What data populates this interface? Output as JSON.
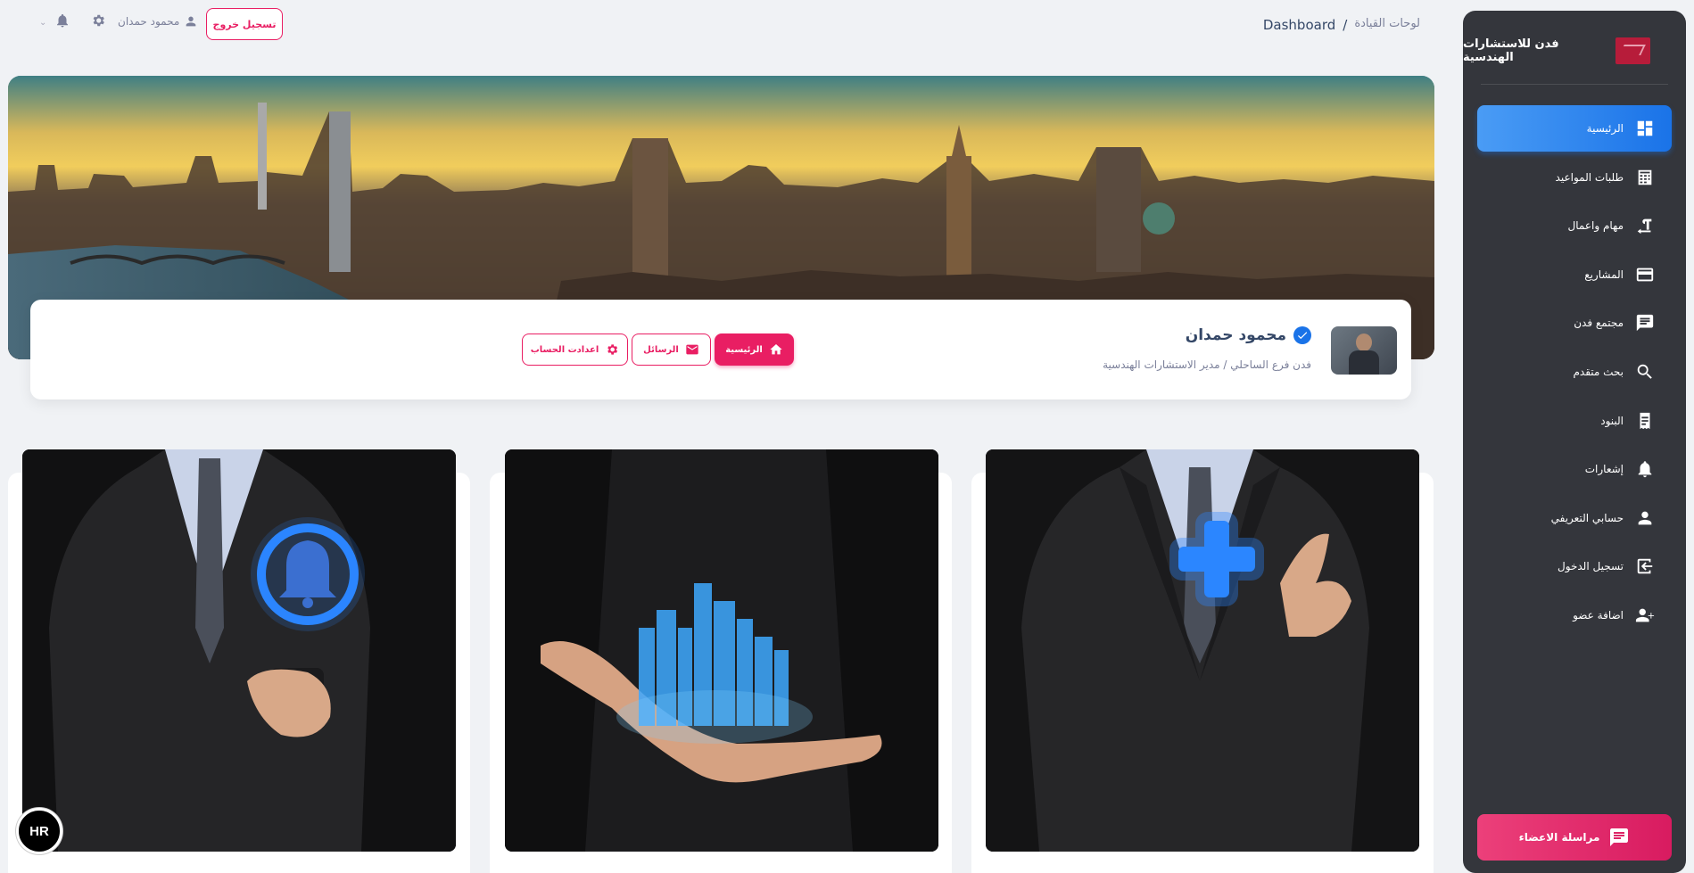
{
  "sidebar": {
    "brand_name": "فدن للاستشارات الهندسية",
    "items": [
      {
        "label": "الرئيسية",
        "icon": "dashboard-icon",
        "active": true
      },
      {
        "label": "طلبات المواعيد",
        "icon": "calendar-icon",
        "active": false
      },
      {
        "label": "مهام واعمال",
        "icon": "tasks-icon",
        "active": false
      },
      {
        "label": "المشاريع",
        "icon": "card-icon",
        "active": false
      },
      {
        "label": "مجتمع فدن",
        "icon": "chat-icon",
        "active": false
      },
      {
        "label": "بحث متقدم",
        "icon": "search-icon",
        "active": false
      },
      {
        "label": "البنود",
        "icon": "receipt-icon",
        "active": false
      },
      {
        "label": "إشعارات",
        "icon": "bell-icon",
        "active": false
      },
      {
        "label": "حسابي التعريفي",
        "icon": "person-icon",
        "active": false
      },
      {
        "label": "تسجيل الدخول",
        "icon": "login-icon",
        "active": false
      },
      {
        "label": "اضافة عضو",
        "icon": "add-person-icon",
        "active": false
      }
    ],
    "members_button": "مراسلة الاعضاء"
  },
  "topbar": {
    "breadcrumb_root": "لوحات القيادة",
    "breadcrumb_separator": "/",
    "breadcrumb_current": "Dashboard",
    "logout_label": "تسجيل خروج",
    "user_name": "محمود حمدان"
  },
  "profile": {
    "name": "محمود حمدان",
    "subtitle": "فدن فرع الساحلي / مدير الاستشارات الهندسية",
    "buttons": {
      "home": "الرئيسية",
      "messages": "الرسائل",
      "settings": "اعدادت الحساب"
    }
  },
  "badge": {
    "text": "HR"
  },
  "colors": {
    "accent": "#e91e63",
    "active_nav": "#1a73e8",
    "sidebar_bg": "#34363c"
  }
}
